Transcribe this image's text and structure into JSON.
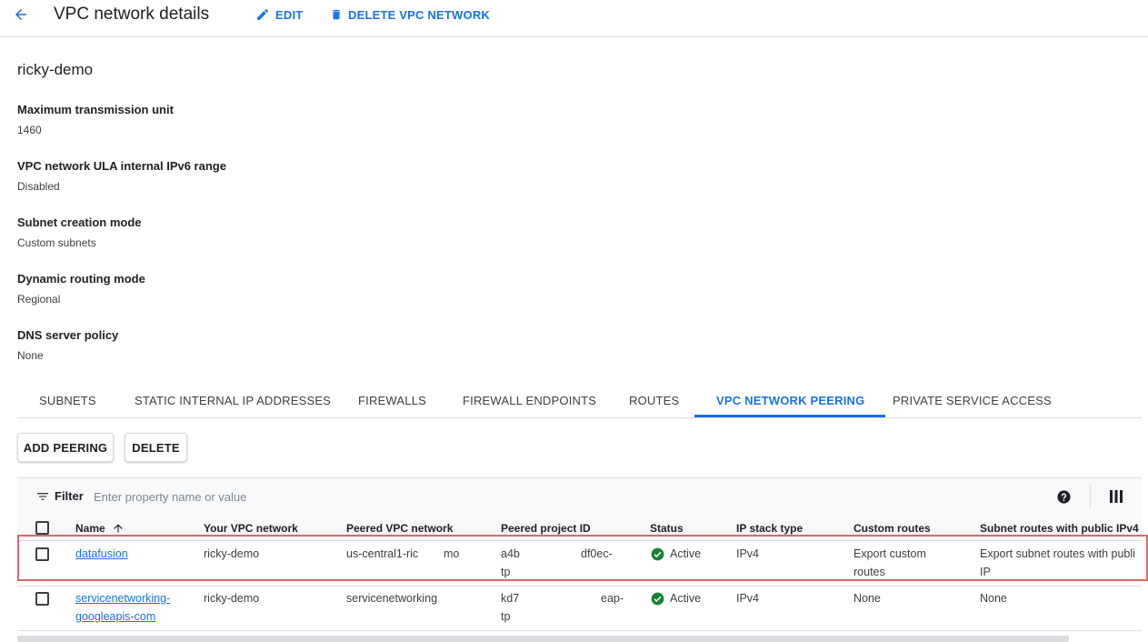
{
  "header": {
    "title": "VPC network details",
    "edit_label": "EDIT",
    "delete_label": "DELETE VPC NETWORK"
  },
  "network": {
    "name": "ricky-demo",
    "properties": [
      {
        "label": "Maximum transmission unit",
        "value": "1460"
      },
      {
        "label": "VPC network ULA internal IPv6 range",
        "value": "Disabled"
      },
      {
        "label": "Subnet creation mode",
        "value": "Custom subnets"
      },
      {
        "label": "Dynamic routing mode",
        "value": "Regional"
      },
      {
        "label": "DNS server policy",
        "value": "None"
      }
    ]
  },
  "tabs": [
    {
      "label": "SUBNETS"
    },
    {
      "label": "STATIC INTERNAL IP ADDRESSES"
    },
    {
      "label": "FIREWALLS"
    },
    {
      "label": "FIREWALL ENDPOINTS"
    },
    {
      "label": "ROUTES"
    },
    {
      "label": "VPC NETWORK PEERING",
      "active": true
    },
    {
      "label": "PRIVATE SERVICE ACCESS"
    }
  ],
  "actions": {
    "add_label": "ADD PEERING",
    "delete_label": "DELETE"
  },
  "filter": {
    "label": "Filter",
    "placeholder": "Enter property name or value"
  },
  "table": {
    "columns": [
      "Name",
      "Your VPC network",
      "Peered VPC network",
      "Peered project ID",
      "Status",
      "IP stack type",
      "Custom routes",
      "Subnet routes with public IPv4"
    ],
    "rows": [
      {
        "name": "datafusion",
        "your_vpc": "ricky-demo",
        "peered_vpc": "us-central1-ric        mo",
        "project_id_1": "a4b",
        "project_id_1b": "df0ec-",
        "project_id_2": "tp",
        "status": "Active",
        "ip_stack": "IPv4",
        "custom_routes_1": "Export custom",
        "custom_routes_2": "routes",
        "subnet_routes_1": "Export subnet routes with publi",
        "subnet_routes_2": "IP"
      },
      {
        "name_1": "servicenetworking-",
        "name_2": "googleapis-com",
        "your_vpc": "ricky-demo",
        "peered_vpc": "servicenetworking",
        "project_id_1": "kd7",
        "project_id_1b": "eap-",
        "project_id_2": "tp",
        "status": "Active",
        "ip_stack": "IPv4",
        "custom_routes_1": "None",
        "subnet_routes_1": "None"
      }
    ]
  },
  "colors": {
    "accent": "#1a73e8",
    "active_status": "#188038",
    "highlight": "#e06666"
  },
  "icons": {
    "back": "arrow-left-icon",
    "edit": "pencil-icon",
    "delete": "trash-icon",
    "filter": "filter-icon",
    "sort": "arrow-up-icon",
    "status": "check-circle-icon",
    "help": "help-circle-icon",
    "columns": "column-display-icon"
  }
}
